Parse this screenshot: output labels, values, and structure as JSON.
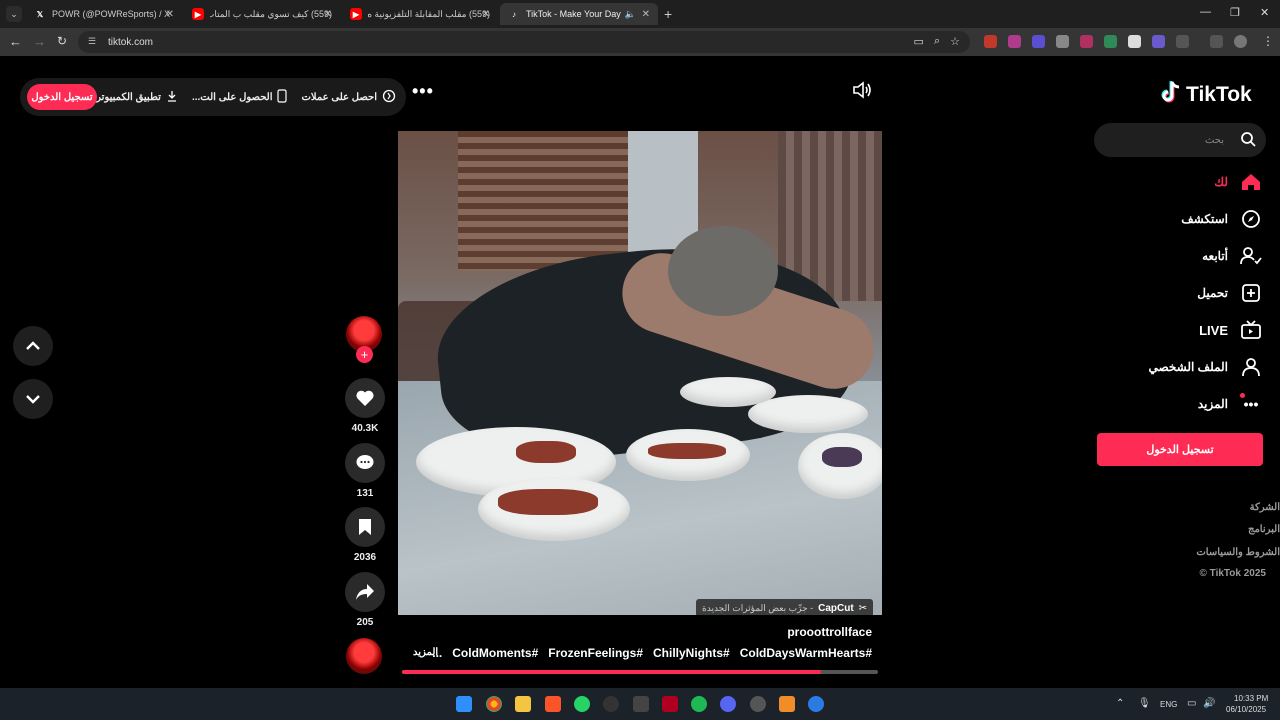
{
  "browser": {
    "tabs": [
      {
        "label": "POWR (@POWReSports) / X",
        "favicon": "x-logo-icon"
      },
      {
        "label": "(559) كيف تسوي مقلب ب المتاب",
        "favicon": "youtube-icon"
      },
      {
        "label": "(559) مقلب المقابلة التلفزيونية ه",
        "favicon": "youtube-icon"
      },
      {
        "label": "TikTok - Make Your Day",
        "favicon": "tiktok-icon"
      }
    ],
    "url": "tiktok.com"
  },
  "top_bar": {
    "coins": "احصل على عملات",
    "get_app": "الحصول على الت...",
    "pc_app": "تطبيق الكمبيوتر",
    "login": "تسجيل الدخول"
  },
  "video": {
    "watermark_brand": "CapCut",
    "watermark_text": "- جرِّب بعض المؤثرات الجديدة",
    "username": "prooottrollface",
    "hashtags": [
      "#ColdDaysWarmHearts",
      "#ChillyNights",
      "#FrozenFeelings",
      "#ColdMoments",
      "..."
    ],
    "more": "المزيد",
    "progress": 0.88
  },
  "actions": {
    "likes": "40.3K",
    "comments": "131",
    "saves": "2036",
    "shares": "205"
  },
  "sidebar": {
    "logo": "TikTok",
    "search_placeholder": "بحث",
    "nav": [
      {
        "label": "لك",
        "icon": "home-icon"
      },
      {
        "label": "استكشف",
        "icon": "compass-icon"
      },
      {
        "label": "أتابعه",
        "icon": "following-icon"
      },
      {
        "label": "تحميل",
        "icon": "upload-icon"
      },
      {
        "label": "LIVE",
        "icon": "live-icon"
      },
      {
        "label": "الملف الشخصي",
        "icon": "profile-icon"
      },
      {
        "label": "المزيد",
        "icon": "more-icon"
      }
    ],
    "login": "تسجيل الدخول",
    "footer": [
      "الشركة",
      "البرنامج",
      "الشروط والسياسات",
      "© TikTok 2025"
    ]
  },
  "taskbar": {
    "language": "ENG",
    "time": "10:33 PM",
    "date": "06/10/2025"
  },
  "colors": {
    "accent": "#fe2c55",
    "background": "#000000"
  }
}
